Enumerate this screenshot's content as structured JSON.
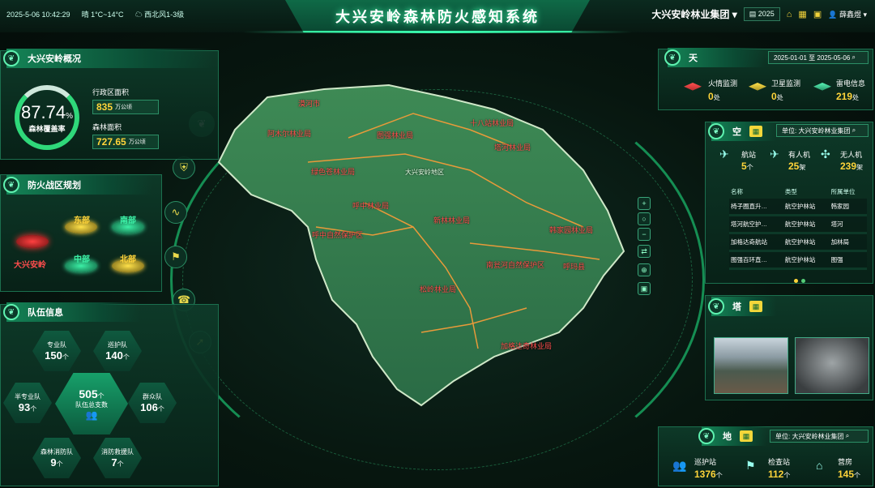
{
  "header": {
    "datetime": "2025-5-06 10:42:29",
    "weather": "晴 1°C~14°C",
    "wind": "西北风1-3级",
    "title": "大兴安岭森林防火感知系统",
    "org": "大兴安岭林业集团",
    "year": "2025",
    "user": "薛鑫煜"
  },
  "overview": {
    "title": "大兴安岭概况",
    "coverage_value": "87.74",
    "coverage_unit": "%",
    "coverage_label": "森林覆盖率",
    "admin_area_label": "行政区面积",
    "admin_area_value": "835",
    "admin_area_unit": "万公顷",
    "forest_area_label": "森林面积",
    "forest_area_value": "727.65",
    "forest_area_unit": "万公顷"
  },
  "zones": {
    "title": "防火战区规划",
    "east": "东部",
    "south": "南部",
    "main": "大兴安岭",
    "center": "中部",
    "north": "北部"
  },
  "teams": {
    "title": "队伍信息",
    "professional_label": "专业队",
    "professional_value": "150",
    "patrol_label": "巡护队",
    "patrol_value": "140",
    "semi_label": "半专业队",
    "semi_value": "93",
    "public_label": "群众队",
    "public_value": "106",
    "forest_fire_label": "森林消防队",
    "forest_fire_value": "9",
    "rescue_label": "消防救援队",
    "rescue_value": "7",
    "total_value": "505",
    "total_label": "队伍总支数",
    "unit": "个"
  },
  "map": {
    "labels": [
      "大兴安岭地区",
      "呼中林业局",
      "新林林业局",
      "塔河林业局",
      "呼中自然保护区",
      "韩家园林业局",
      "南瓮河自然保护区",
      "呼玛县",
      "松岭林业局",
      "加格达奇林业局",
      "漠河市",
      "阿木尔林业局",
      "图强林业局",
      "十八站林业局",
      "绿色苍林业局"
    ]
  },
  "sky": {
    "title": "天",
    "date_range": "2025-01-01 至 2025-05-06",
    "fire_label": "火情监测",
    "fire_value": "0",
    "sat_label": "卫星监测",
    "sat_value": "0",
    "thunder_label": "雷电信息",
    "thunder_value": "219",
    "unit": "处"
  },
  "air": {
    "title": "空",
    "unit_label": "单位: 大兴安岭林业集团",
    "station_label": "航站",
    "station_value": "5",
    "station_unit": "个",
    "manned_label": "有人机",
    "manned_value": "25",
    "manned_unit": "架",
    "drone_label": "无人机",
    "drone_value": "239",
    "drone_unit": "架",
    "columns": [
      "名称",
      "类型",
      "所属单位"
    ],
    "rows": [
      [
        "椅子圈直升…",
        "航空护林站",
        "韩家园"
      ],
      [
        "塔河航空护…",
        "航空护林站",
        "塔河"
      ],
      [
        "加格达奇航站",
        "航空护林站",
        "加林局"
      ],
      [
        "图强百环直…",
        "航空护林站",
        "图强"
      ]
    ]
  },
  "tower": {
    "title": "塔"
  },
  "ground": {
    "title": "地",
    "unit_label": "单位: 大兴安岭林业集团",
    "patrol_label": "巡护站",
    "patrol_value": "1376",
    "check_label": "检查站",
    "check_value": "112",
    "house_label": "营房",
    "house_value": "145",
    "unit": "个"
  },
  "colors": {
    "accent": "#34e29a",
    "gold": "#ffd43a",
    "panel": "#0e3c2a"
  }
}
